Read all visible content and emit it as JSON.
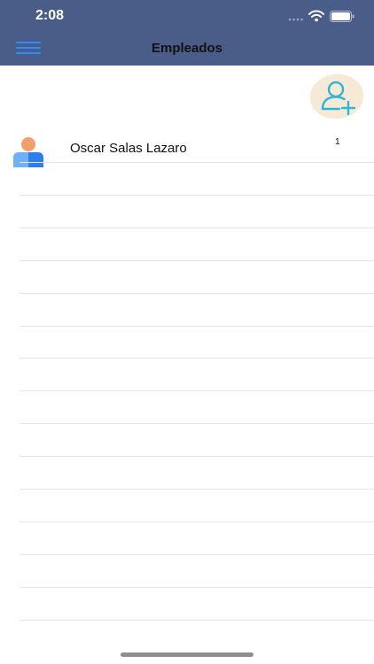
{
  "status": {
    "time": "2:08"
  },
  "header": {
    "title": "Empleados"
  },
  "employees": [
    {
      "name": "Oscar Salas Lazaro",
      "count": "1"
    }
  ],
  "colors": {
    "header_bg": "#4a5c88",
    "menu_icon": "#2d8cff",
    "add_bg": "#f6ead7",
    "add_icon": "#2fb6d6",
    "avatar_head": "#f3a06d",
    "avatar_body_left": "#6fb1f6",
    "avatar_body_right": "#2d7cf0"
  },
  "icons": {
    "menu": "hamburger-menu-icon",
    "add": "add-user-icon",
    "avatar": "user-avatar-icon",
    "signal": "cellular-signal-icon",
    "wifi": "wifi-icon",
    "battery": "battery-icon"
  }
}
